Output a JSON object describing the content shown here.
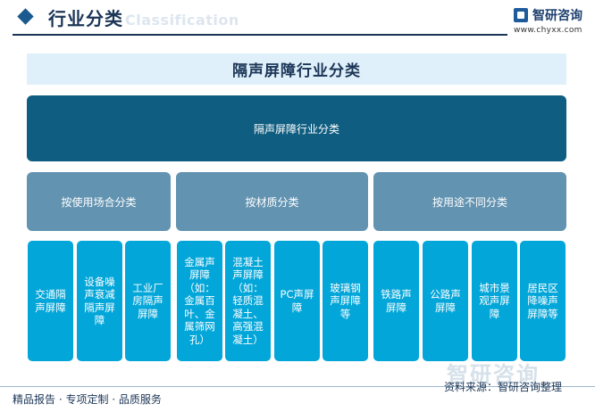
{
  "header": {
    "title": "行业分类",
    "subtitle_en": "Classification"
  },
  "logo": {
    "name": "智研咨询",
    "url": "www.chyxx.com"
  },
  "diagram": {
    "title": "隔声屏障行业分类",
    "root": "隔声屏障行业分类",
    "categories": [
      {
        "label": "按使用场合分类",
        "items": [
          "交通隔声屏障",
          "设备噪声衰减隔声屏障",
          "工业厂房隔声屏障"
        ]
      },
      {
        "label": "按材质分类",
        "items": [
          "金属声屏障（如：金属百叶、金属筛网孔）",
          "混凝土声屏障（如：轻质混凝土、高强混凝土）",
          "PC声屏障",
          "玻璃钢声屏障等"
        ]
      },
      {
        "label": "按用途不同分类",
        "items": [
          "铁路声屏障",
          "公路声屏障",
          "城市景观声屏障",
          "居民区降噪声屏障等"
        ]
      }
    ]
  },
  "footer": {
    "left": "精品报告 · 专项定制 · 品质服务",
    "source": "资料来源：智研咨询整理"
  },
  "watermark": "智研咨询"
}
